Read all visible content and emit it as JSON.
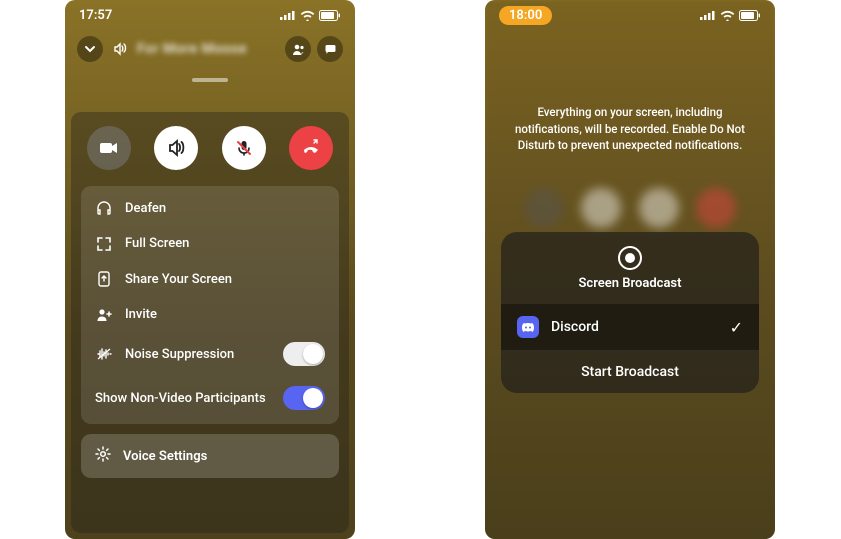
{
  "phone1": {
    "status": {
      "time": "17:57"
    },
    "header": {
      "channel_name": "For More Moose"
    },
    "menu": {
      "deafen": "Deafen",
      "full_screen": "Full Screen",
      "share_screen": "Share Your Screen",
      "invite": "Invite",
      "noise_suppression": "Noise Suppression",
      "show_non_video": "Show Non-Video Participants"
    },
    "voice_settings_label": "Voice Settings"
  },
  "phone2": {
    "status": {
      "time": "18:00"
    },
    "disclaimer": "Everything on your screen, including notifications, will be recorded. Enable Do Not Disturb to prevent unexpected notifications.",
    "broadcast": {
      "title": "Screen Broadcast",
      "app_name": "Discord",
      "start_label": "Start Broadcast"
    }
  }
}
